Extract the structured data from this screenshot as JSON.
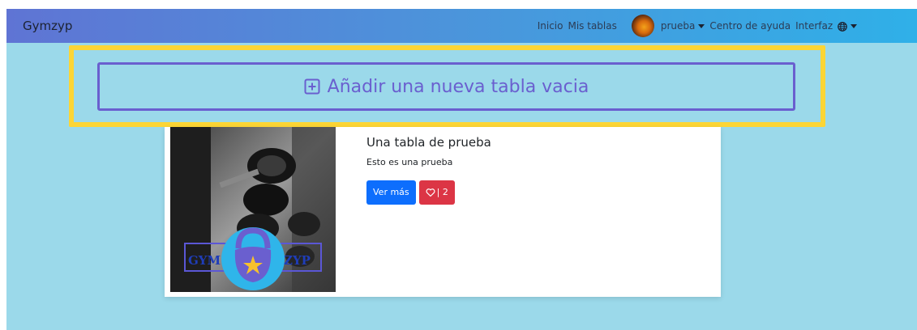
{
  "navbar": {
    "brand": "Gymzyp",
    "links": {
      "inicio": "Inicio",
      "mis_tablas": "Mis tablas",
      "user": "prueba",
      "ayuda": "Centro de ayuda",
      "interfaz": "Interfaz"
    }
  },
  "add_table": {
    "label": "Añadir una nueva tabla vacia"
  },
  "card": {
    "title": "Una tabla de prueba",
    "description": "Esto es una prueba",
    "view_more": "Ver más",
    "likes": "| 2",
    "logo_text_left": "GYM",
    "logo_text_right": "ZYP"
  },
  "colors": {
    "navbar_start": "#5f74d4",
    "navbar_end": "#2fb0e8",
    "page_bg": "#9bd9ea",
    "highlight": "#fcd535",
    "accent_purple": "#6a5fcf",
    "primary": "#0d6efd",
    "danger": "#dc3545"
  }
}
